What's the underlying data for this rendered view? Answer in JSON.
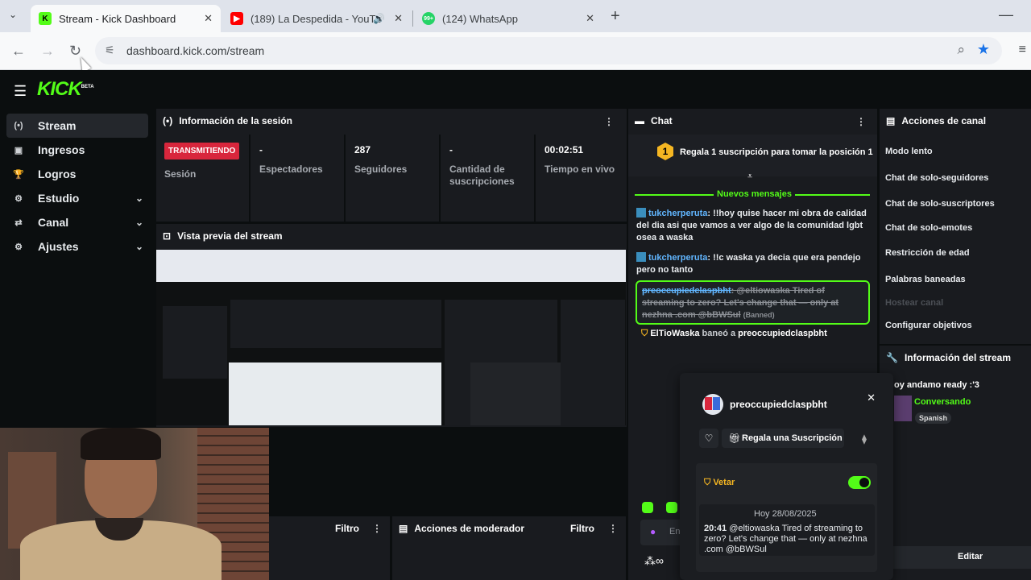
{
  "browser": {
    "tabs": [
      {
        "title": "Stream - Kick Dashboard",
        "favicon": "K",
        "color": "#53fc18"
      },
      {
        "title": "(189) La Despedida - YouTu",
        "favicon": "▶",
        "color": "#ff0000"
      },
      {
        "title": "(124) WhatsApp",
        "favicon": "99+",
        "color": "#25d366"
      }
    ],
    "url": "dashboard.kick.com/stream"
  },
  "app": {
    "logo": "KICK",
    "logo_badge": "BETA",
    "sidebar": [
      {
        "label": "Stream",
        "icon": "(•)",
        "active": true,
        "expandable": false
      },
      {
        "label": "Ingresos",
        "icon": "▣",
        "active": false,
        "expandable": false
      },
      {
        "label": "Logros",
        "icon": "🏆",
        "active": false,
        "expandable": false
      },
      {
        "label": "Estudio",
        "icon": "⚙",
        "active": false,
        "expandable": true
      },
      {
        "label": "Canal",
        "icon": "⇄",
        "active": false,
        "expandable": true
      },
      {
        "label": "Ajustes",
        "icon": "⚙",
        "active": false,
        "expandable": true
      }
    ]
  },
  "session": {
    "title": "Información de la sesión",
    "status_badge": "TRANSMITIENDO",
    "status_label": "Sesión",
    "stats": [
      {
        "value": "-",
        "label": "Espectadores"
      },
      {
        "value": "287",
        "label": "Seguidores"
      },
      {
        "value": "-",
        "label": "Cantidad de suscripciones"
      },
      {
        "value": "00:02:51",
        "label": "Tiempo en vivo"
      }
    ]
  },
  "preview": {
    "title": "Vista previa del stream"
  },
  "chat": {
    "title": "Chat",
    "pinned": "Regala 1 suscripción para tomar la posición 1",
    "pinned_rank": "1",
    "new_messages": "Nuevos mensajes",
    "messages": [
      {
        "user": "tukcherperuta",
        "text": "!!hoy quise hacer mi obra de calidad del dia asi que vamos a ver algo de la comunidad lgbt osea a waska"
      },
      {
        "user": "tukcherperuta",
        "text": "!!c waska ya decia que era pendejo pero no tanto"
      }
    ],
    "banned_msg": {
      "user": "preoccupiedclaspbht",
      "text": "@eltiowaska Tired of streaming to zero? Let's change that — only at nezhna .com @bBWSul",
      "tag": "(Banned)"
    },
    "ban_notice": {
      "mod": "ElTioWaska",
      "action": "baneó a",
      "target": "preoccupiedclaspbht"
    }
  },
  "channel_actions": {
    "title": "Acciones de canal",
    "items": [
      {
        "label": "Modo lento",
        "disabled": false
      },
      {
        "label": "Chat de solo-seguidores",
        "disabled": false
      },
      {
        "label": "Chat de solo-suscriptores",
        "disabled": false
      },
      {
        "label": "Chat de solo-emotes",
        "disabled": false
      },
      {
        "label": "Restricción de edad",
        "disabled": false
      },
      {
        "label": "Palabras baneadas",
        "disabled": false
      },
      {
        "label": "Hostear canal",
        "disabled": true
      },
      {
        "label": "Configurar objetivos",
        "disabled": false
      }
    ]
  },
  "stream_info": {
    "title": "Información del stream",
    "stream_title": "oy andamo ready :'3",
    "category": "Conversando",
    "language": "Spanish",
    "edit": "Editar"
  },
  "popup": {
    "username": "preoccupiedclaspbht",
    "gift_button": "Regala una Suscripción",
    "veto_label": "Vetar",
    "veto_on": true,
    "date": "Hoy 28/08/2025",
    "time": "20:41",
    "message": "@eltiowaska Tired of streaming to zero? Let's change that — only at nezhna .com @bBWSul"
  },
  "moderator": {
    "filter_label": "Filtro",
    "title": "Acciones de moderador",
    "filter_label_2": "Filtro"
  },
  "chat_input": {
    "placeholder": "En"
  }
}
